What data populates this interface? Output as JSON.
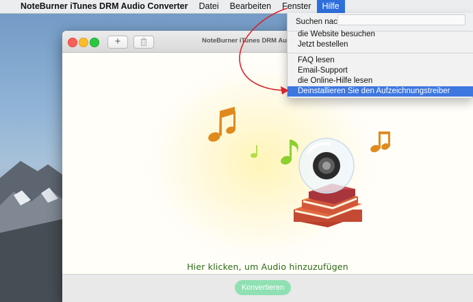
{
  "menubar": {
    "app_name": "NoteBurner iTunes DRM Audio Converter",
    "items": [
      "Datei",
      "Bearbeiten",
      "Fenster",
      "Hilfe"
    ],
    "active_item": "Hilfe"
  },
  "window": {
    "title": "NoteBurner iTunes DRM Audi",
    "toolbar": {
      "add_label": "+",
      "delete_icon": "trash-icon"
    },
    "hint": "Hier klicken, um Audio hinzuzufügen",
    "convert_label": "Konvertieren"
  },
  "help_menu": {
    "search_label": "Suchen nach",
    "search_value": "",
    "items": [
      "die Website besuchen",
      "Jetzt bestellen",
      "FAQ lesen",
      "Email-Support",
      "die Online-Hilfe lesen",
      "Deinstallieren Sie den Aufzeichnungstreiber"
    ],
    "highlighted": "Deinstallieren Sie den Aufzeichnungstreiber"
  },
  "colors": {
    "menu_highlight": "#3d77e0",
    "hint_text": "#2a6a12",
    "convert_button": "#8fe0b3",
    "annotation_arrow": "#d8232a"
  }
}
